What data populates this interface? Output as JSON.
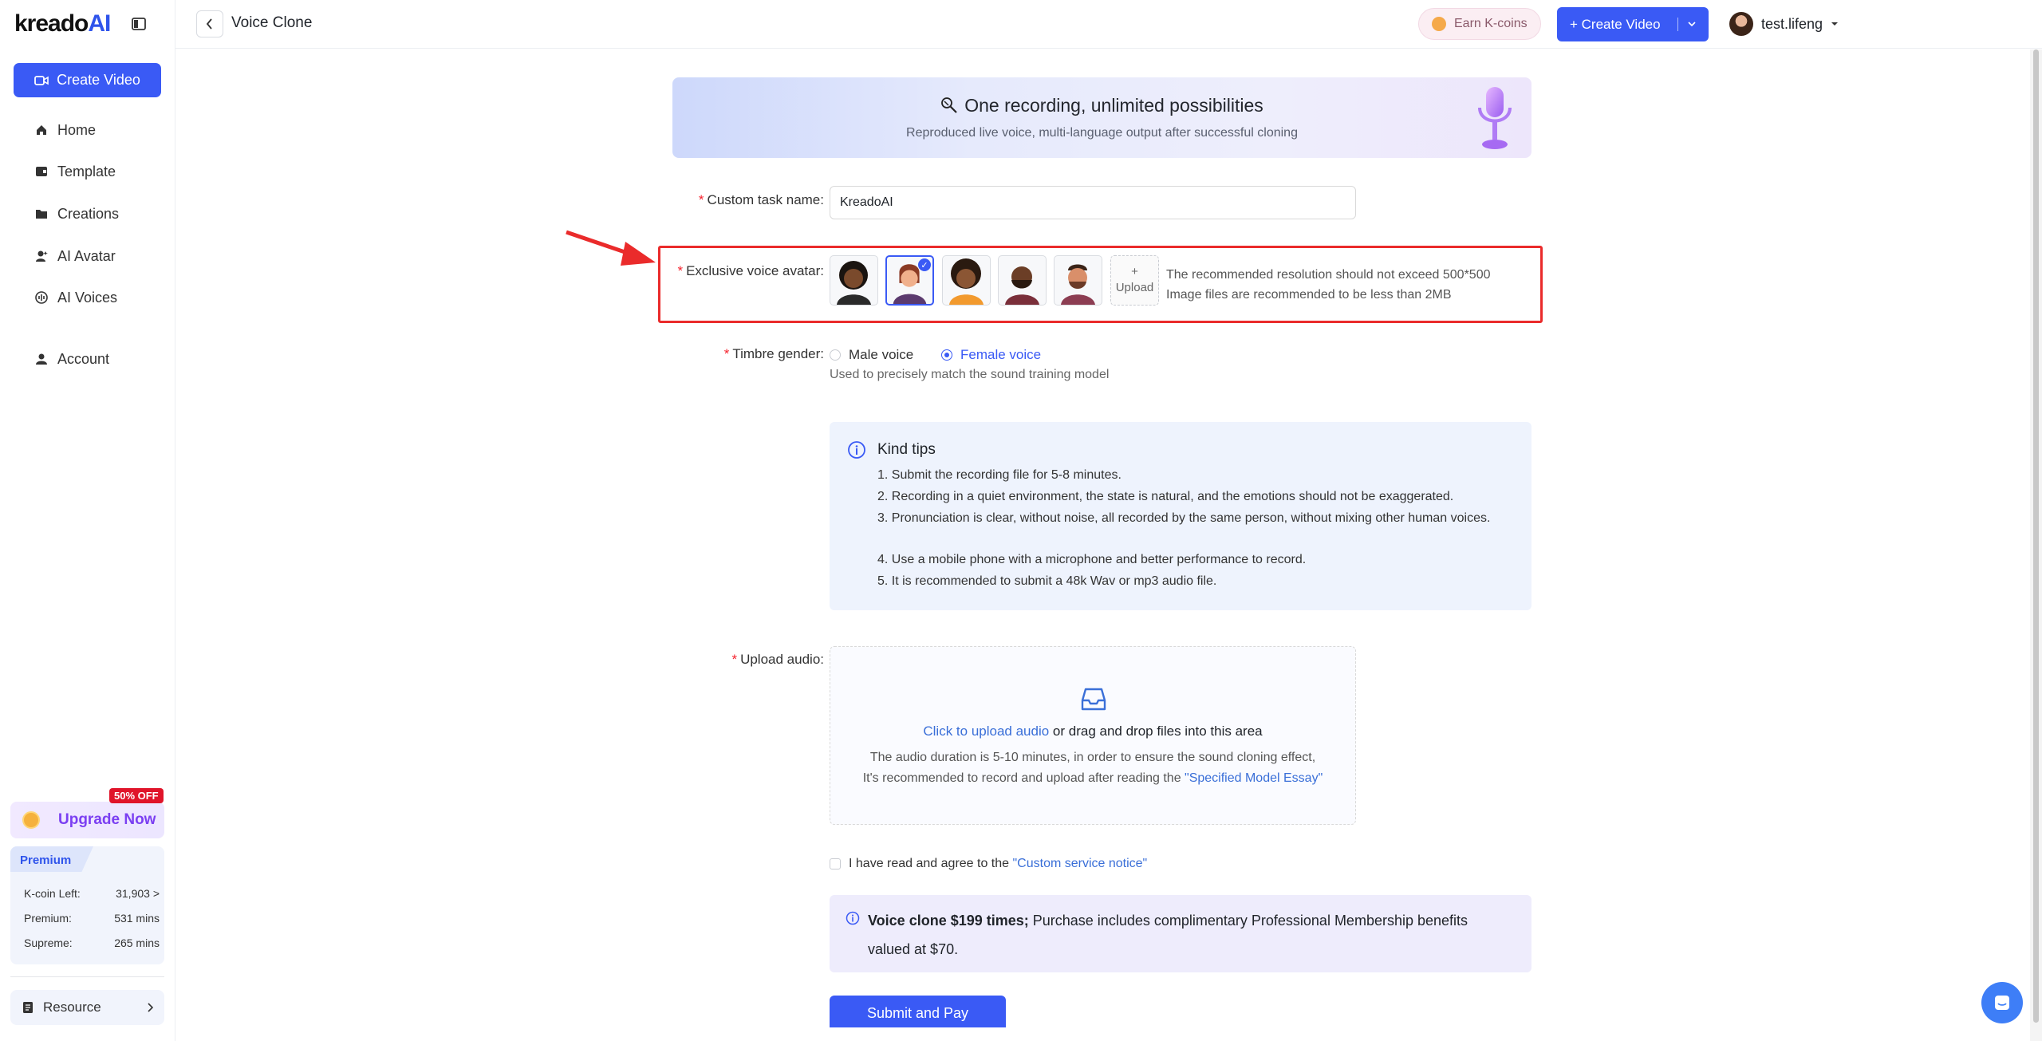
{
  "app": {
    "logo_text": "kreado",
    "logo_ai": "AI"
  },
  "sidebar": {
    "create_label": "Create Video",
    "items": [
      {
        "label": "Home",
        "icon": "home-icon"
      },
      {
        "label": "Template",
        "icon": "template-icon"
      },
      {
        "label": "Creations",
        "icon": "folder-icon"
      },
      {
        "label": "AI Avatar",
        "icon": "avatar-icon"
      },
      {
        "label": "AI Voices",
        "icon": "voice-icon"
      },
      {
        "label": "Account",
        "icon": "user-icon"
      }
    ],
    "promo_badge": "50% OFF",
    "upgrade_label": "Upgrade Now",
    "plan": {
      "name": "Premium",
      "kcoin_label": "K-coin Left:",
      "kcoin_value": "31,903 >",
      "premium_label": "Premium:",
      "premium_value": "531 mins",
      "supreme_label": "Supreme:",
      "supreme_value": "265 mins"
    },
    "resource_label": "Resource"
  },
  "header": {
    "title": "Voice Clone",
    "earn_label": "Earn K-coins",
    "create_label": "+ Create Video",
    "username": "test.lifeng"
  },
  "banner": {
    "title": "One recording, unlimited possibilities",
    "subtitle": "Reproduced live voice, multi-language output after successful cloning"
  },
  "form": {
    "task_name_label": "Custom task name:",
    "task_name_value": "KreadoAI",
    "avatar_label": "Exclusive voice avatar:",
    "avatar_selected_index": 1,
    "upload_plus": "+",
    "upload_label": "Upload",
    "avatar_hint_1": "The recommended resolution should not exceed 500*500",
    "avatar_hint_2": "Image files are recommended to be less than 2MB",
    "gender_label": "Timbre gender:",
    "gender_male": "Male voice",
    "gender_female": "Female voice",
    "gender_selected": "Female voice",
    "gender_hint": "Used to precisely match the sound training model",
    "audio_label": "Upload audio:"
  },
  "tips": {
    "title": "Kind tips",
    "items": [
      "1. Submit the recording file for 5-8 minutes.",
      "2. Recording in a quiet environment, the state is natural, and the emotions should not be exaggerated.",
      "3. Pronunciation is clear, without noise, all recorded by the same person, without mixing other human voices.",
      "4. Use a mobile phone with a microphone and better performance to record.",
      "5. It is recommended to submit a 48k Wav or mp3 audio file."
    ]
  },
  "upload": {
    "link": "Click to upload audio",
    "rest": " or drag and drop files into this area",
    "line2": "The audio duration is 5-10 minutes, in order to ensure the sound cloning effect,",
    "line3_prefix": "It's recommended to record and upload after reading the ",
    "line3_link": "\"Specified Model Essay\""
  },
  "agree": {
    "text": "I have read and agree to the ",
    "link": "\"Custom service notice\""
  },
  "notice": {
    "bold": "Voice clone $199 times;",
    "rest": " Purchase includes complimentary Professional Membership benefits valued at $70."
  },
  "submit_label": "Submit and Pay",
  "colors": {
    "accent": "#3a5af5",
    "highlight_box": "#ea2b2b",
    "upgrade": "#7b3ff2"
  }
}
